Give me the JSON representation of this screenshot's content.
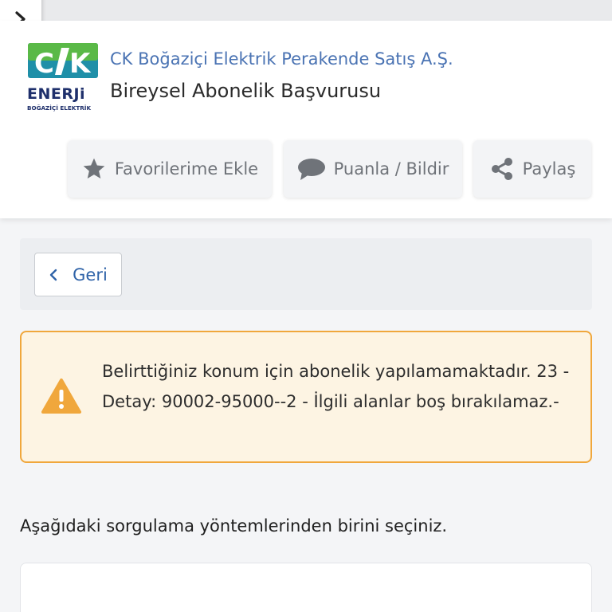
{
  "header": {
    "org_name": "CK Boğaziçi Elektrik Perakende Satış A.Ş.",
    "service_name": "Bireysel Abonelik Başvurusu",
    "logo": {
      "mark_text": "C/K",
      "brand_text": "ENERJi",
      "sub_text": "BOĞAZİÇİ ELEKTRİK",
      "colors": {
        "green": "#5ab947",
        "teal": "#1f8fa8",
        "navy": "#1e2f6b"
      }
    }
  },
  "actions": [
    {
      "label": "Favorilerime Ekle",
      "icon": "star-icon"
    },
    {
      "label": "Puanla / Bildir",
      "icon": "speech-bubble-icon"
    },
    {
      "label": "Paylaş",
      "icon": "share-icon"
    }
  ],
  "nav": {
    "back_label": "Geri",
    "back_icon": "chevron-left-icon",
    "menu_icon": "chevron-right-icon"
  },
  "alert": {
    "icon": "warning-icon",
    "message": "Belirttiğiniz konum için abonelik yapılamamaktadır. 23 - Detay: 90002-95000--2 - İlgili alanlar boş bırakılamaz.-"
  },
  "instruction": "Aşağıdaki sorgulama yöntemlerinden birini seçiniz.",
  "colors": {
    "link_blue": "#4a73b3",
    "alert_border": "#f0a73c",
    "alert_bg": "#fdf4e3",
    "warning_icon": "#f0a73c"
  }
}
